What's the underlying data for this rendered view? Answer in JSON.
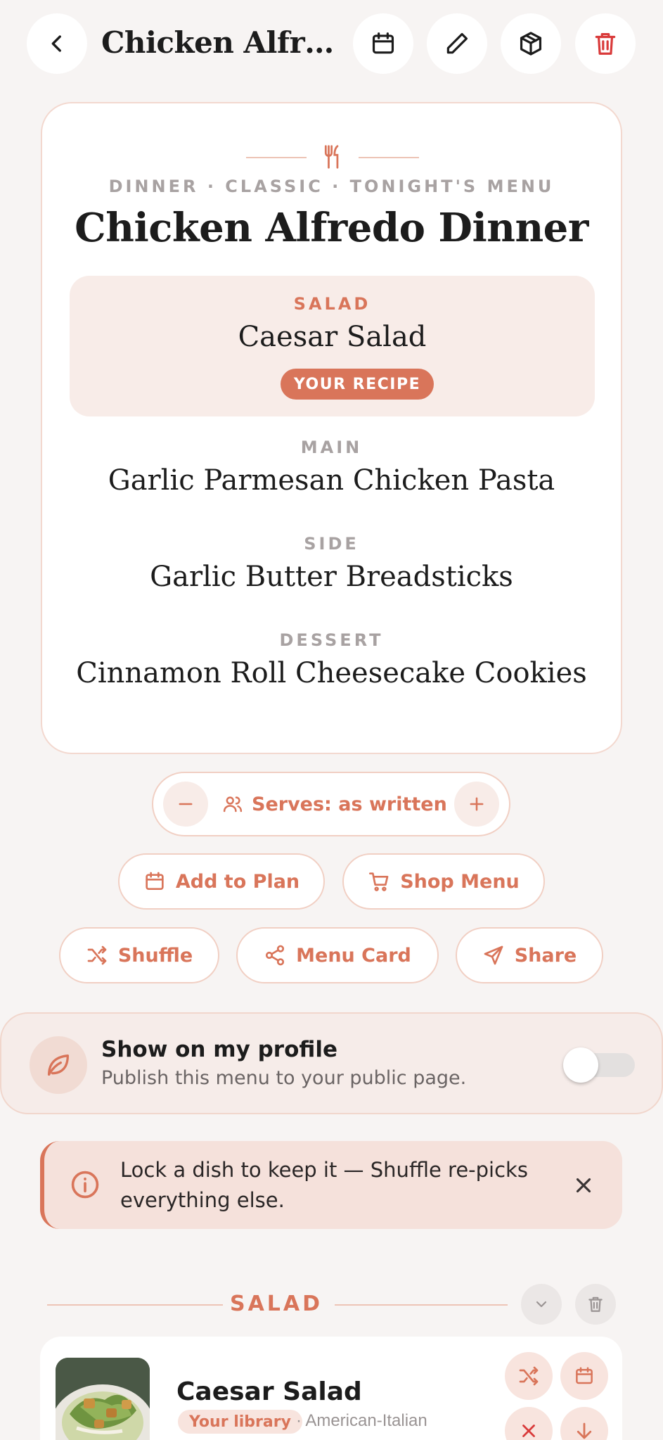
{
  "header": {
    "title": "Chicken Alfred...",
    "icons": [
      "back-chevron-icon",
      "calendar-icon",
      "pencil-icon",
      "box-icon",
      "trash-icon"
    ]
  },
  "menu": {
    "eyebrow": "DINNER · CLASSIC · TONIGHT'S MENU",
    "title": "Chicken Alfredo Dinner",
    "courses": [
      {
        "label": "SALAD",
        "name": "Caesar Salad",
        "badge": "YOUR RECIPE"
      },
      {
        "label": "MAIN",
        "name": "Garlic Parmesan Chicken Pasta"
      },
      {
        "label": "SIDE",
        "name": "Garlic Butter Breadsticks"
      },
      {
        "label": "DESSERT",
        "name": "Cinnamon Roll Cheesecake Cookies"
      }
    ]
  },
  "serves": {
    "label": "Serves: as written"
  },
  "actions": {
    "add_to_plan": "Add to Plan",
    "shop_menu": "Shop Menu",
    "shuffle": "Shuffle",
    "menu_card": "Menu Card",
    "share": "Share"
  },
  "profile": {
    "title": "Show on my profile",
    "subtitle": "Publish this menu to your public page.",
    "toggle_on": false
  },
  "tip": {
    "text": "Lock a dish to keep it — Shuffle re-picks everything else."
  },
  "section": {
    "label": "SALAD",
    "recipe": {
      "name": "Caesar Salad",
      "badge": "Your library",
      "cuisine": "· American-Italian"
    }
  },
  "colors": {
    "accent": "#d9755a",
    "background": "#f7f4f3",
    "danger": "#d93a3a"
  }
}
